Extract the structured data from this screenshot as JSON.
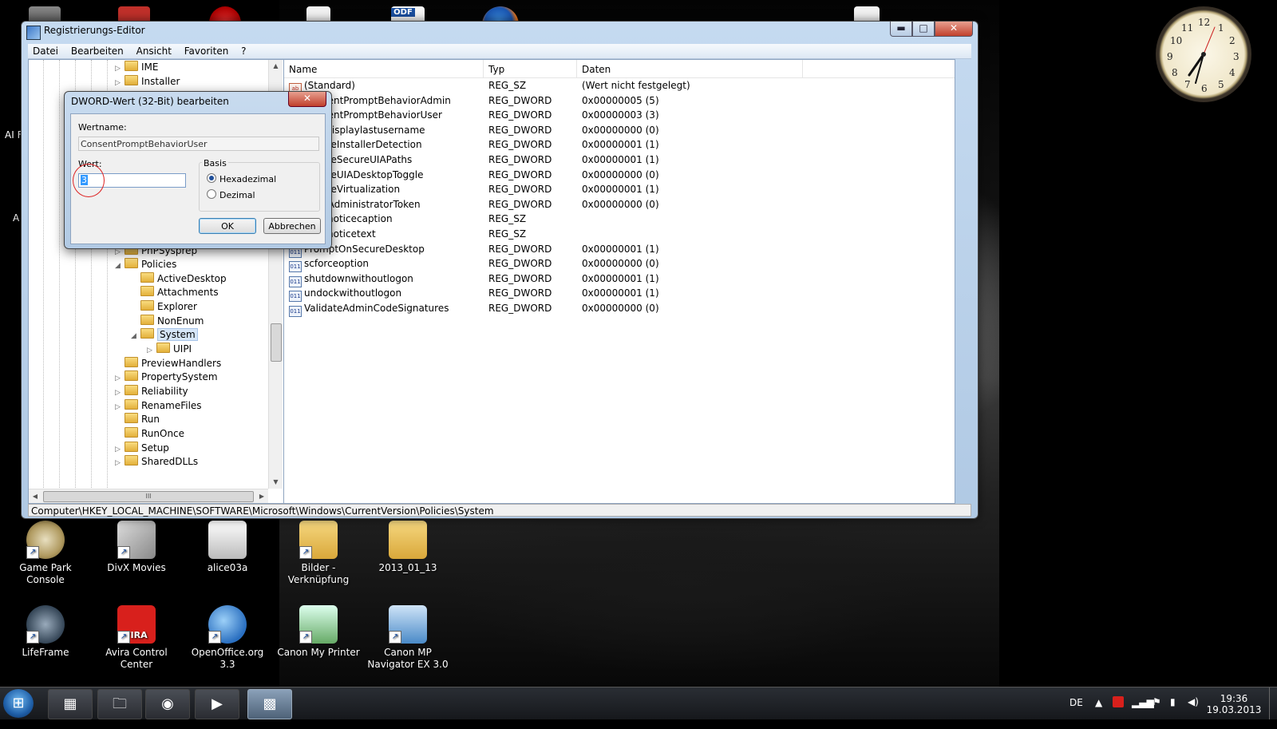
{
  "window": {
    "title": "Registrierungs-Editor",
    "min": "▬",
    "max": "□",
    "close": "✕",
    "menu": [
      "Datei",
      "Bearbeiten",
      "Ansicht",
      "Favoriten",
      "?"
    ],
    "status_path": "Computer\\HKEY_LOCAL_MACHINE\\SOFTWARE\\Microsoft\\Windows\\CurrentVersion\\Policies\\System"
  },
  "tree": {
    "items": [
      {
        "label": "IME"
      },
      {
        "label": "Installer"
      },
      {
        "label": "PnPSysprep"
      },
      {
        "label": "Policies"
      },
      {
        "label": "ActiveDesktop"
      },
      {
        "label": "Attachments"
      },
      {
        "label": "Explorer"
      },
      {
        "label": "NonEnum"
      },
      {
        "label": "System"
      },
      {
        "label": "UIPI"
      },
      {
        "label": "PreviewHandlers"
      },
      {
        "label": "PropertySystem"
      },
      {
        "label": "Reliability"
      },
      {
        "label": "RenameFiles"
      },
      {
        "label": "Run"
      },
      {
        "label": "RunOnce"
      },
      {
        "label": "Setup"
      },
      {
        "label": "SharedDLLs"
      }
    ],
    "hscroll_grip": "III"
  },
  "list": {
    "headers": {
      "name": "Name",
      "type": "Typ",
      "data": "Daten"
    },
    "rows": [
      {
        "name": "(Standard)",
        "type": "REG_SZ",
        "data": "(Wert nicht festgelegt)",
        "icon": "ab"
      },
      {
        "name": "ConsentPromptBehaviorAdmin",
        "type": "REG_DWORD",
        "data": "0x00000005 (5)",
        "icon": "dw"
      },
      {
        "name": "ConsentPromptBehaviorUser",
        "type": "REG_DWORD",
        "data": "0x00000003 (3)",
        "icon": "dw"
      },
      {
        "name": "dontdisplaylastusername",
        "type": "REG_DWORD",
        "data": "0x00000000 (0)",
        "icon": "dw"
      },
      {
        "name": "EnableInstallerDetection",
        "type": "REG_DWORD",
        "data": "0x00000001 (1)",
        "icon": "dw"
      },
      {
        "name": "EnableSecureUIAPaths",
        "type": "REG_DWORD",
        "data": "0x00000001 (1)",
        "icon": "dw"
      },
      {
        "name": "EnableUIADesktopToggle",
        "type": "REG_DWORD",
        "data": "0x00000000 (0)",
        "icon": "dw"
      },
      {
        "name": "EnableVirtualization",
        "type": "REG_DWORD",
        "data": "0x00000001 (1)",
        "icon": "dw"
      },
      {
        "name": "FilterAdministratorToken",
        "type": "REG_DWORD",
        "data": "0x00000000 (0)",
        "icon": "dw"
      },
      {
        "name": "legalnoticecaption",
        "type": "REG_SZ",
        "data": "",
        "icon": "ab"
      },
      {
        "name": "legalnoticetext",
        "type": "REG_SZ",
        "data": "",
        "icon": "ab"
      },
      {
        "name": "PromptOnSecureDesktop",
        "type": "REG_DWORD",
        "data": "0x00000001 (1)",
        "icon": "dw"
      },
      {
        "name": "scforceoption",
        "type": "REG_DWORD",
        "data": "0x00000000 (0)",
        "icon": "dw"
      },
      {
        "name": "shutdownwithoutlogon",
        "type": "REG_DWORD",
        "data": "0x00000001 (1)",
        "icon": "dw"
      },
      {
        "name": "undockwithoutlogon",
        "type": "REG_DWORD",
        "data": "0x00000001 (1)",
        "icon": "dw"
      },
      {
        "name": "ValidateAdminCodeSignatures",
        "type": "REG_DWORD",
        "data": "0x00000000 (0)",
        "icon": "dw"
      }
    ]
  },
  "dialog": {
    "title": "DWORD-Wert (32-Bit) bearbeiten",
    "close": "✕",
    "valuename_label": "Wertname:",
    "valuename": "ConsentPromptBehaviorUser",
    "value_label": "Wert:",
    "value": "3",
    "basis_label": "Basis",
    "hex_label": "Hexadezimal",
    "dec_label": "Dezimal",
    "selected_basis": "Hexadezimal",
    "ok_label": "OK",
    "cancel_label": "Abbrechen"
  },
  "desktop": {
    "left_edge_text_1": "AI F",
    "left_edge_text_2": "A",
    "icons_row1": [
      {
        "label": "Game Park Console"
      },
      {
        "label": "DivX Movies"
      },
      {
        "label": "alice03a"
      },
      {
        "label": "Bilder - Verknüpfung"
      },
      {
        "label": "2013_01_13"
      }
    ],
    "icons_row2": [
      {
        "label": "LifeFrame"
      },
      {
        "label": "Avira Control Center"
      },
      {
        "label": "OpenOffice.org 3.3"
      },
      {
        "label": "Canon My Printer"
      },
      {
        "label": "Canon MP Navigator EX 3.0"
      }
    ],
    "top_odf_label": "ODF",
    "avira_badge": "VIRA"
  },
  "clock": {
    "numbers": [
      "12",
      "1",
      "2",
      "3",
      "4",
      "5",
      "6",
      "7",
      "8",
      "9",
      "10",
      "11"
    ]
  },
  "taskbar": {
    "language": "DE",
    "time": "19:36",
    "date": "19.03.2013"
  },
  "colors": {
    "accent": "#3399ff",
    "annotation_red": "#dd2222"
  }
}
